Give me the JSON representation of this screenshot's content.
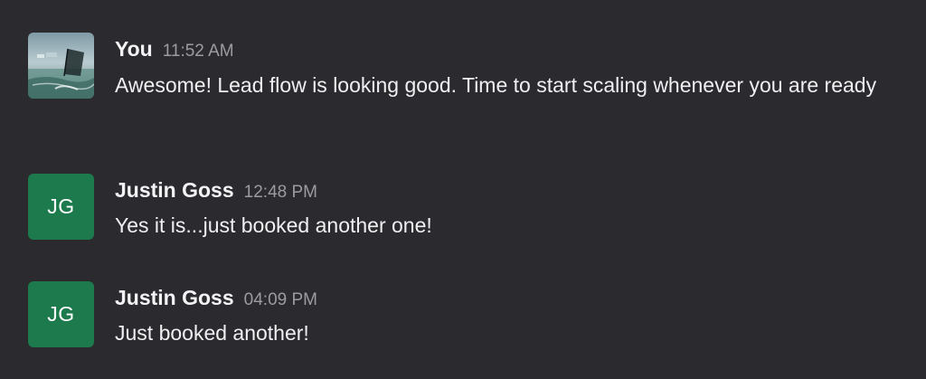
{
  "colors": {
    "background": "#2b2b2f",
    "avatar_green": "#1c7a4c",
    "timestamp": "#9b9ba1",
    "text": "#f0f0f2"
  },
  "messages": [
    {
      "sender": "You",
      "time": "11:52 AM",
      "text": "Awesome! Lead flow is looking good. Time to start scaling whenever you are ready",
      "avatar": {
        "type": "photo",
        "icon": "windsurfer-photo"
      }
    },
    {
      "sender": "Justin Goss",
      "time": "12:48 PM",
      "text": "Yes it is...just booked another one!",
      "avatar": {
        "type": "initials",
        "initials": "JG"
      }
    },
    {
      "sender": "Justin Goss",
      "time": "04:09 PM",
      "text": "Just booked another!",
      "avatar": {
        "type": "initials",
        "initials": "JG"
      }
    }
  ]
}
